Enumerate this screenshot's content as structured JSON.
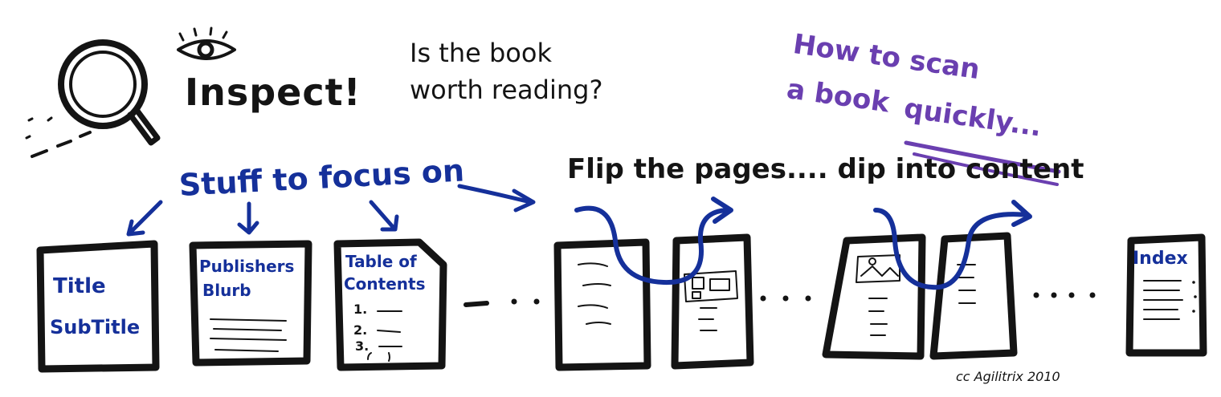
{
  "header": {
    "title": "Inspect!",
    "question_line1": "Is the book",
    "question_line2": "worth reading?"
  },
  "tagline": {
    "line1": "How to scan",
    "line2_prefix": "a book",
    "line2_emphasis": "quickly..."
  },
  "labels": {
    "focus": "Stuff to focus on",
    "flip": "Flip the pages.... dip into content"
  },
  "pages": {
    "title_page_line1": "Title",
    "title_page_line2": "SubTitle",
    "blurb_line1": "Publishers",
    "blurb_line2": "Blurb",
    "toc_line1": "Table of",
    "toc_line2": "Contents",
    "toc_item1": "1.",
    "toc_item2": "2.",
    "toc_item3": "3.",
    "index": "Index"
  },
  "credit": "cc Agilitrix 2010",
  "colors": {
    "ink": "#141414",
    "blue": "#15309a",
    "purple": "#6a3fb0"
  },
  "icons": [
    "eye-icon",
    "magnifying-glass-icon"
  ]
}
